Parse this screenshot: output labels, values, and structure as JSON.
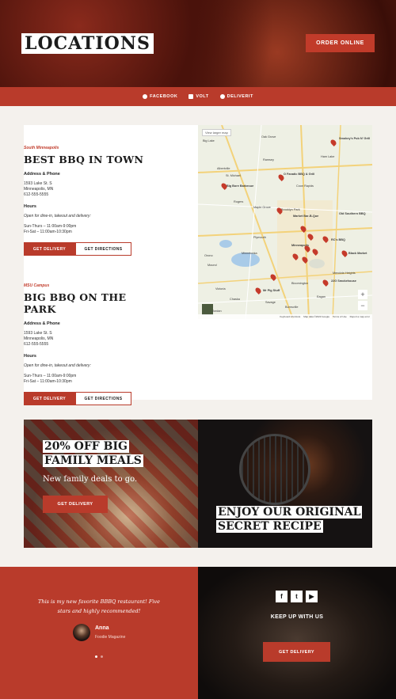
{
  "hero": {
    "title": "LOCATIONS",
    "order_button": "ORDER ONLINE"
  },
  "social": [
    {
      "label": "FACEBOOK",
      "icon": "facebook-icon"
    },
    {
      "label": "VOLT",
      "icon": "volt-icon"
    },
    {
      "label": "DELIVERIT",
      "icon": "deliverit-icon"
    }
  ],
  "locations": [
    {
      "kicker": "South Minneapolis",
      "title": "BEST BBQ IN TOWN",
      "address_heading": "Address & Phone",
      "address_lines": [
        "1593 Lake St. S",
        "Minneapolis, MN",
        "612-555-5555"
      ],
      "hours_heading": "Hours",
      "hours_note": "Open for dine-in, takeout and delivery:",
      "hours_lines": [
        "Sun-Thurs – 11:00am-9:00pm",
        "Fri-Sat – 11:00am-10:30pm"
      ],
      "delivery_button": "GET DELIVERY",
      "directions_button": "GET DIRECTIONS"
    },
    {
      "kicker": "MSU Campus",
      "title": "BIG BBQ ON THE PARK",
      "address_heading": "Address & Phone",
      "address_lines": [
        "1593 Lake St. S",
        "Minneapolis, MN",
        "612-555-5555"
      ],
      "hours_heading": "Hours",
      "hours_note": "Open for dine-in, takeout and delivery:",
      "hours_lines": [
        "Sun-Thurs – 11:00am-9:00pm",
        "Fri-Sat – 11:00am-10:30pm"
      ],
      "delivery_button": "GET DELIVERY",
      "directions_button": "GET DIRECTIONS"
    }
  ],
  "map": {
    "view_larger": "View larger map",
    "places": [
      "Oak Grove",
      "Smokey's Pub N' Grill",
      "Big Lake",
      "Ramsey",
      "Ham Lake",
      "Albertville",
      "St. Michael",
      "O Fanatic BBQ & Grill",
      "Coon Rapids",
      "Big Bore Barbecue",
      "Rogers",
      "Maple Grove",
      "Brooklyn Park",
      "Market Bar-B-Que",
      "Old Southern BBQ",
      "Plymouth",
      "Minnetonka",
      "Minneapolis",
      "RC's BBQ",
      "Black Market",
      "Orono",
      "Mound",
      "Chaska",
      "Victoria",
      "Bloomington",
      "22G Smokehouse",
      "Mendota Heights",
      "Mr Pig Stuff",
      "Eagan",
      "Savage",
      "Burnsville",
      "Jordan"
    ],
    "footer": [
      "Keyboard shortcuts",
      "Map data ©2023 Google",
      "Terms of Use",
      "Report a map error"
    ],
    "zoom_in": "+",
    "zoom_out": "−"
  },
  "promo_left": {
    "title_line1": "20% OFF BIG",
    "title_line2": "FAMILY MEALS",
    "subtitle": "New family deals to go.",
    "button": "GET DELIVERY"
  },
  "promo_right": {
    "title_line1": "ENJOY OUR ORIGINAL",
    "title_line2": "SECRET RECIPE"
  },
  "testimonial": {
    "quote": "This is my new favorite BBBQ restaurant! Five stars and highly recommended!",
    "author": "Anna",
    "org": "Foodie Magazine"
  },
  "social_follow": {
    "icons": [
      "facebook-icon",
      "twitter-icon",
      "youtube-icon"
    ],
    "heading": "KEEP UP WITH US",
    "button": "GET DELIVERY"
  }
}
